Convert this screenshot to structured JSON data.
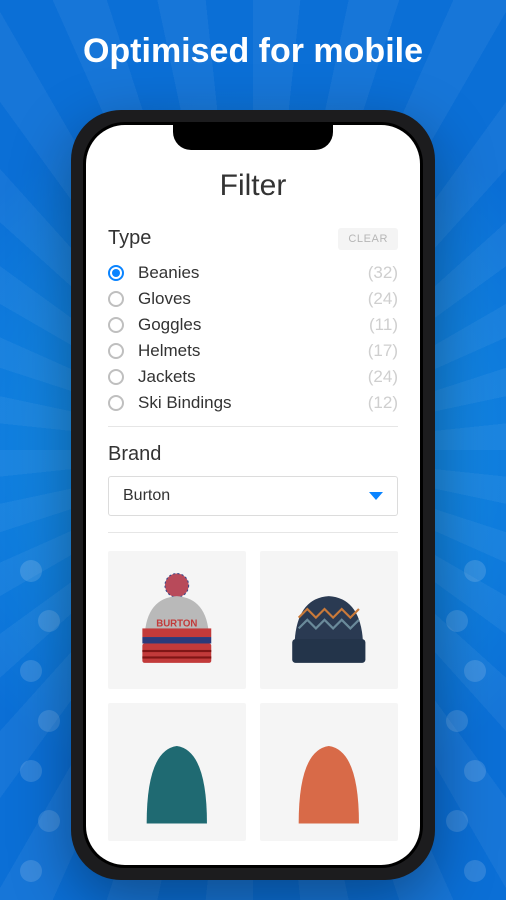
{
  "headline": "Optimised for mobile",
  "filter": {
    "title": "Filter",
    "type_label": "Type",
    "clear_label": "CLEAR",
    "types": [
      {
        "label": "Beanies",
        "count": "(32)",
        "selected": true
      },
      {
        "label": "Gloves",
        "count": "(24)",
        "selected": false
      },
      {
        "label": "Goggles",
        "count": "(11)",
        "selected": false
      },
      {
        "label": "Helmets",
        "count": "(17)",
        "selected": false
      },
      {
        "label": "Jackets",
        "count": "(24)",
        "selected": false
      },
      {
        "label": "Ski Bindings",
        "count": "(12)",
        "selected": false
      }
    ],
    "brand_label": "Brand",
    "brand_value": "Burton"
  },
  "products": [
    {
      "name": "beanie-pompom-grey-red"
    },
    {
      "name": "beanie-folded-navy-pattern"
    },
    {
      "name": "beanie-teal"
    },
    {
      "name": "beanie-orange"
    }
  ]
}
